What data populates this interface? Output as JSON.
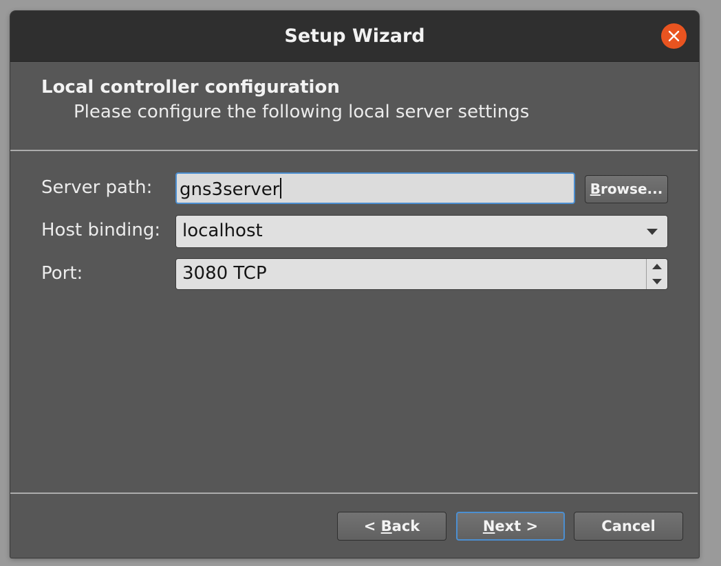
{
  "window": {
    "title": "Setup Wizard",
    "accent": "#e95420",
    "focus_color": "#4c8fd1"
  },
  "page": {
    "heading": "Local controller configuration",
    "subheading": "Please configure the following local server settings"
  },
  "form": {
    "server_path": {
      "label": "Server path:",
      "value": "gns3server"
    },
    "browse_button": {
      "label_mnemonic": "B",
      "label_rest": "rowse..."
    },
    "host_binding": {
      "label": "Host binding:",
      "value": "localhost"
    },
    "port": {
      "label": "Port:",
      "value": "3080 TCP"
    }
  },
  "footer": {
    "back": {
      "prefix": "< ",
      "mnemonic": "B",
      "rest": "ack"
    },
    "next": {
      "mnemonic": "N",
      "rest": "ext >"
    },
    "cancel": {
      "label": "Cancel"
    }
  },
  "icons": {
    "close": "close-icon",
    "dropdown": "chevron-down-icon",
    "spin_up": "spin-up-icon",
    "spin_down": "spin-down-icon"
  }
}
